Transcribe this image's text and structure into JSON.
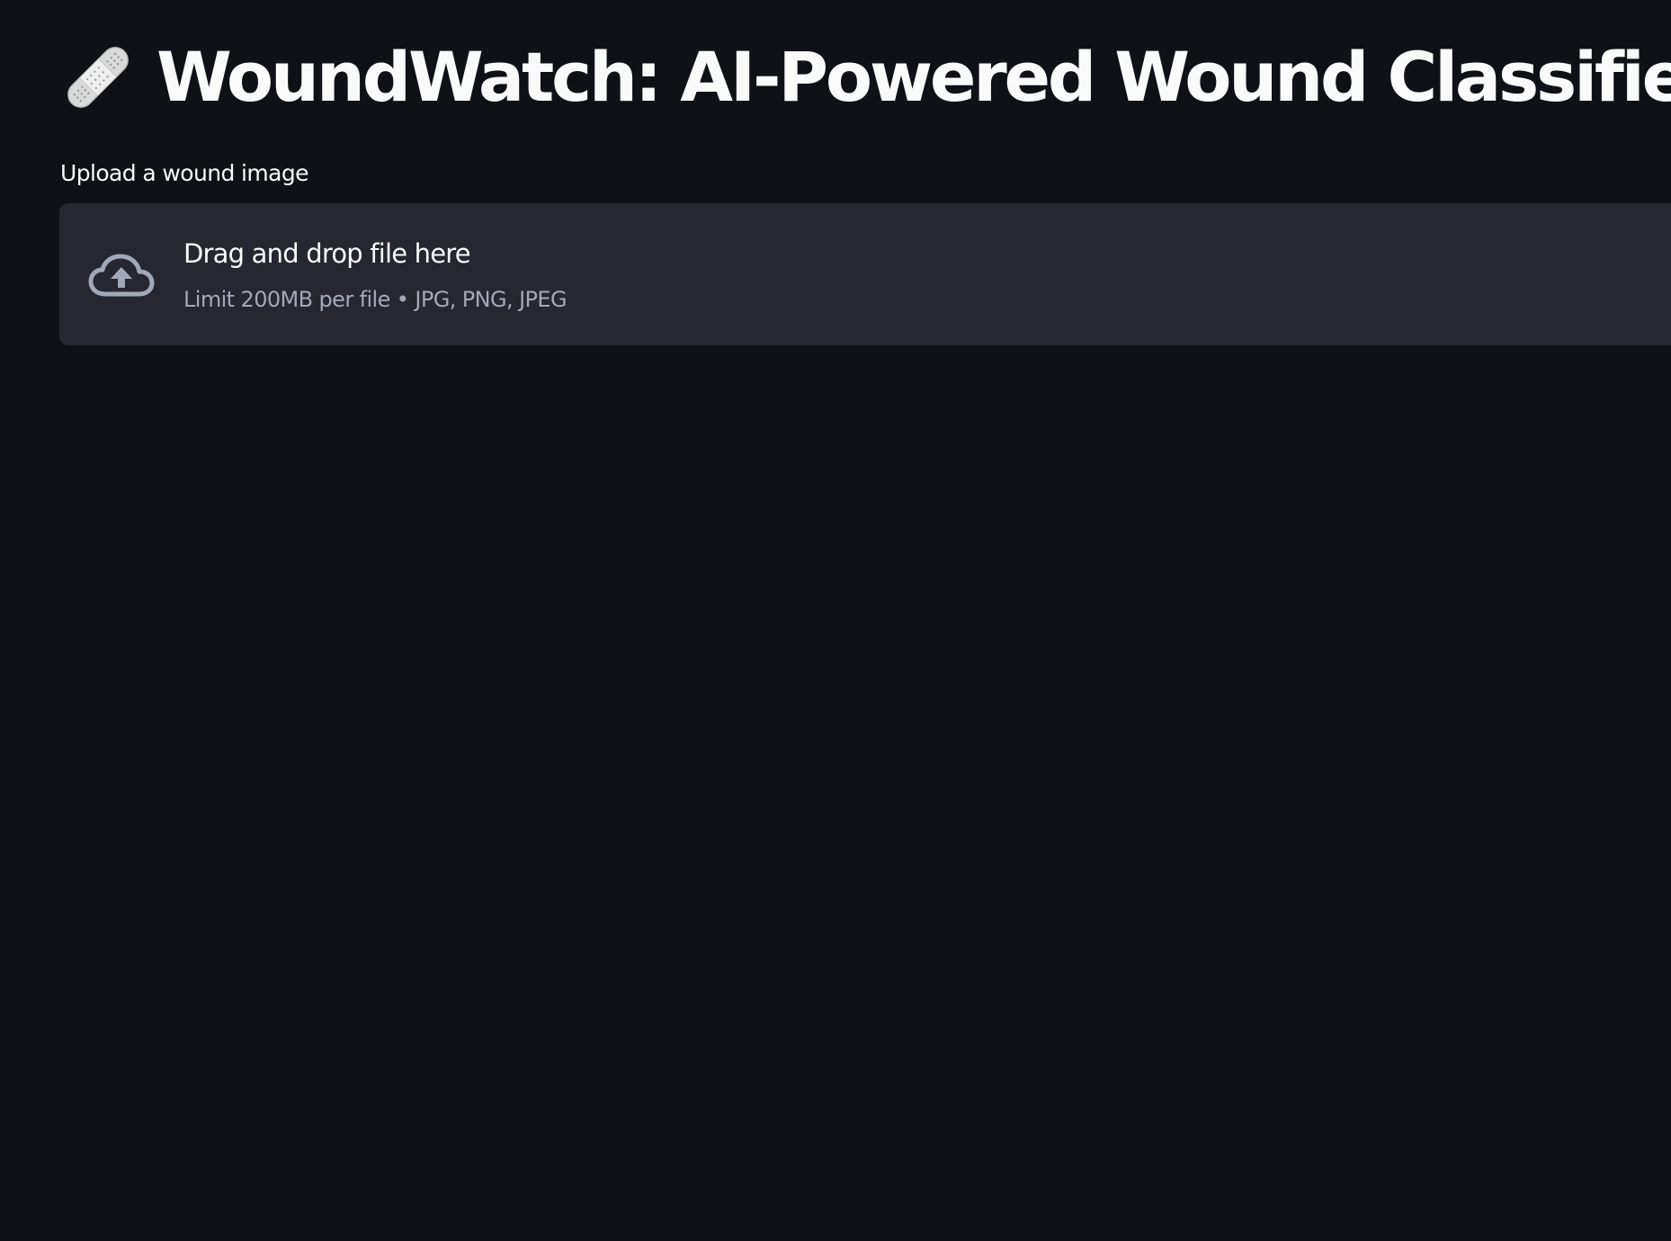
{
  "header": {
    "icon": "adhesive-bandage-icon",
    "title": "WoundWatch: AI-Powered Wound Classifier"
  },
  "uploader": {
    "label": "Upload a wound image",
    "icon": "cloud-upload-icon",
    "drop_text": "Drag and drop file here",
    "limit_text": "Limit 200MB per file • JPG, PNG, JPEG"
  },
  "colors": {
    "background": "#0f1116",
    "dropzone": "#262730",
    "text": "#fafafa",
    "muted_text": "#a3a8b8",
    "icon": "#a3a8b8"
  }
}
